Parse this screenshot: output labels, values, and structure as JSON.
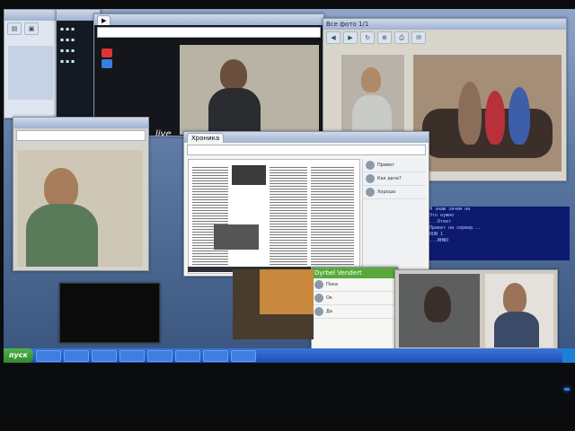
{
  "screen": {
    "browser_tab": "Хроника",
    "zvonok_title": "Все фото 1/1",
    "live_label": "live",
    "chat_contact": "Dyrbel Vendert",
    "terminal_lines": [
      "> Я знаю зачем на",
      "> Это нужно",
      ">  ...Ответ",
      "> Привет на сервер...",
      "> RUN 1",
      ">   ...ИНФО"
    ],
    "messages": [
      "Привет",
      "Как дела?",
      "Хорошо",
      "Пока",
      "Ок",
      "Да"
    ]
  },
  "taskbar": {
    "start_label": "пуск"
  },
  "colors": {
    "taskbar": "#1c4fb8",
    "skype": "#59a83b",
    "led": "#2f7dff"
  }
}
